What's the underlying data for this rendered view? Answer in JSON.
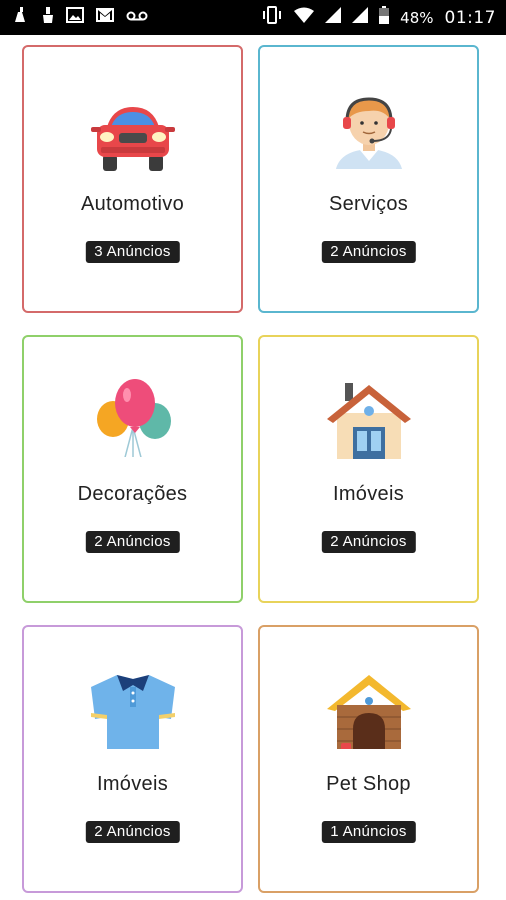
{
  "status_bar": {
    "battery": "48%",
    "time": "01:17",
    "icons_left": [
      "cleaner-icon",
      "brush-icon",
      "image-icon",
      "gmail-icon",
      "voicemail-icon"
    ],
    "icons_right": [
      "vibrate-icon",
      "wifi-icon",
      "signal-icon",
      "signal-icon",
      "battery-icon"
    ]
  },
  "categories": [
    {
      "name": "Automotivo",
      "count": "3 Anúncios",
      "icon": "car-icon",
      "border": "#d46a6a"
    },
    {
      "name": "Serviços",
      "count": "2 Anúncios",
      "icon": "support-agent-icon",
      "border": "#5ab6cf"
    },
    {
      "name": "Decorações",
      "count": "2 Anúncios",
      "icon": "balloons-icon",
      "border": "#8fd06a"
    },
    {
      "name": "Imóveis",
      "count": "2 Anúncios",
      "icon": "house-icon",
      "border": "#e8d35a"
    },
    {
      "name": "Imóveis",
      "count": "2 Anúncios",
      "icon": "shirt-icon",
      "border": "#c79ad9"
    },
    {
      "name": "Pet Shop",
      "count": "1 Anúncios",
      "icon": "doghouse-icon",
      "border": "#d9a066"
    }
  ]
}
